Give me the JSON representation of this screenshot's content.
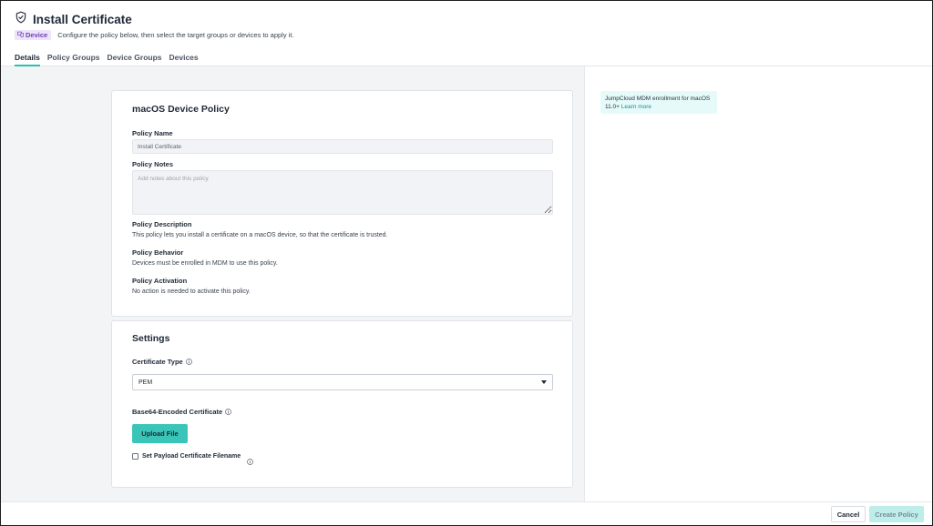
{
  "header": {
    "title": "Install Certificate",
    "title_icon": "shield-check-icon",
    "badge_label": "Device",
    "badge_icon": "devices-icon",
    "subtitle": "Configure the policy below, then select the target groups or devices to apply it."
  },
  "tabs": [
    {
      "label": "Details",
      "active": true
    },
    {
      "label": "Policy Groups",
      "active": false
    },
    {
      "label": "Device Groups",
      "active": false
    },
    {
      "label": "Devices",
      "active": false
    }
  ],
  "policy_card": {
    "title": "macOS Device Policy",
    "name_label": "Policy Name",
    "name_value": "Install Certificate",
    "notes_label": "Policy Notes",
    "notes_placeholder": "Add notes about this policy",
    "description_label": "Policy Description",
    "description_text": "This policy lets you install a certificate on a macOS device, so that the certificate is trusted.",
    "behavior_label": "Policy Behavior",
    "behavior_text": "Devices must be enrolled in MDM to use this policy.",
    "activation_label": "Policy Activation",
    "activation_text": "No action is needed to activate this policy."
  },
  "settings_card": {
    "title": "Settings",
    "cert_type_label": "Certificate Type",
    "cert_type_value": "PEM",
    "base64_label": "Base64-Encoded Certificate",
    "upload_label": "Upload File",
    "checkbox_label": "Set Payload Certificate Filename",
    "checkbox_checked": false
  },
  "side_note": {
    "text": "JumpCloud MDM enrollment for macOS 11.0+",
    "link": "Learn more"
  },
  "footer": {
    "cancel_label": "Cancel",
    "create_label": "Create Policy"
  },
  "colors": {
    "accent": "#3bc5b9",
    "badge_bg": "#ede3fb",
    "badge_text": "#6b3fb3",
    "note_bg": "#e6fbf9",
    "link": "#1c8b98"
  }
}
